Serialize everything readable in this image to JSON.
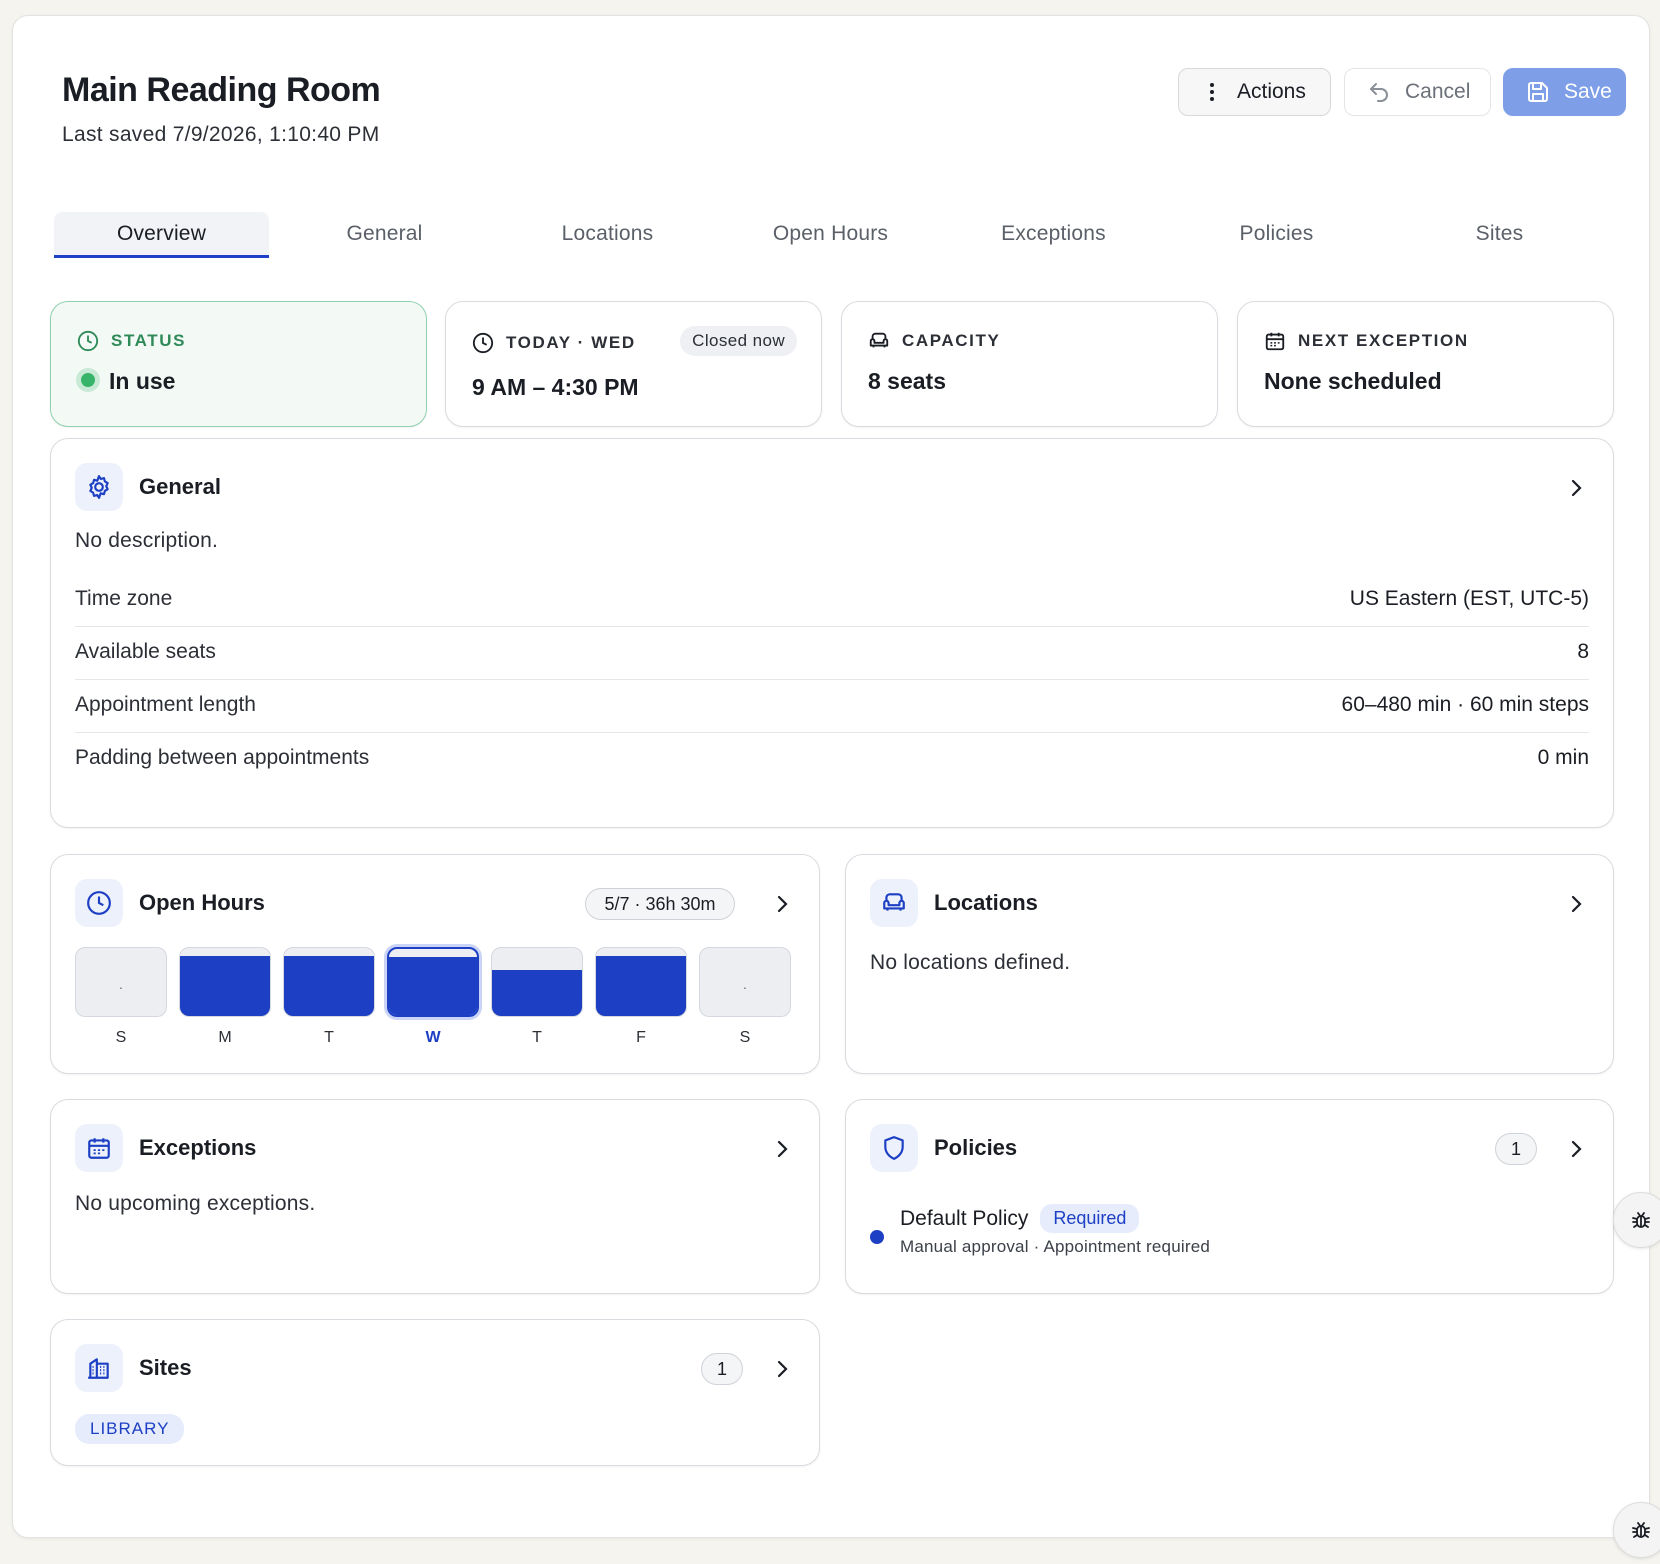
{
  "header": {
    "title": "Main Reading Room",
    "last_saved": "Last saved 7/9/2026, 1:10:40 PM",
    "actions_label": "Actions",
    "cancel_label": "Cancel",
    "save_label": "Save"
  },
  "tabs": [
    {
      "label": "Overview",
      "active": true
    },
    {
      "label": "General"
    },
    {
      "label": "Locations"
    },
    {
      "label": "Open Hours"
    },
    {
      "label": "Exceptions"
    },
    {
      "label": "Policies"
    },
    {
      "label": "Sites"
    }
  ],
  "stats": {
    "status": {
      "label": "STATUS",
      "value": "In use"
    },
    "today": {
      "label": "TODAY · WED",
      "value": "9 AM – 4:30 PM",
      "badge": "Closed now"
    },
    "capacity": {
      "label": "CAPACITY",
      "value": "8 seats"
    },
    "next_exception": {
      "label": "NEXT EXCEPTION",
      "value": "None scheduled"
    }
  },
  "general": {
    "title": "General",
    "description": "No description.",
    "rows": [
      {
        "key": "Time zone",
        "value": "US Eastern (EST, UTC-5)"
      },
      {
        "key": "Available seats",
        "value": "8"
      },
      {
        "key": "Appointment length",
        "value": "60–480 min · 60 min steps"
      },
      {
        "key": "Padding between appointments",
        "value": "0 min"
      }
    ]
  },
  "open_hours": {
    "title": "Open Hours",
    "summary": "5/7 · 36h 30m",
    "days": [
      {
        "letter": "S",
        "fill": 0,
        "closed_mark": "."
      },
      {
        "letter": "M",
        "fill": 0.88
      },
      {
        "letter": "T",
        "fill": 0.88
      },
      {
        "letter": "W",
        "fill": 0.88,
        "today": true
      },
      {
        "letter": "T",
        "fill": 0.68
      },
      {
        "letter": "F",
        "fill": 0.88
      },
      {
        "letter": "S",
        "fill": 0,
        "closed_mark": "."
      }
    ]
  },
  "locations": {
    "title": "Locations",
    "empty_text": "No locations defined."
  },
  "exceptions": {
    "title": "Exceptions",
    "empty_text": "No upcoming exceptions."
  },
  "policies": {
    "title": "Policies",
    "count": "1",
    "items": [
      {
        "name": "Default Policy",
        "badge": "Required",
        "meta": "Manual approval · Appointment required"
      }
    ]
  },
  "sites": {
    "title": "Sites",
    "count": "1",
    "chips": [
      "LIBRARY"
    ]
  },
  "colors": {
    "accent": "#1c3fc4",
    "status_green": "#38b46a",
    "save_button": "#7e9fe8"
  }
}
